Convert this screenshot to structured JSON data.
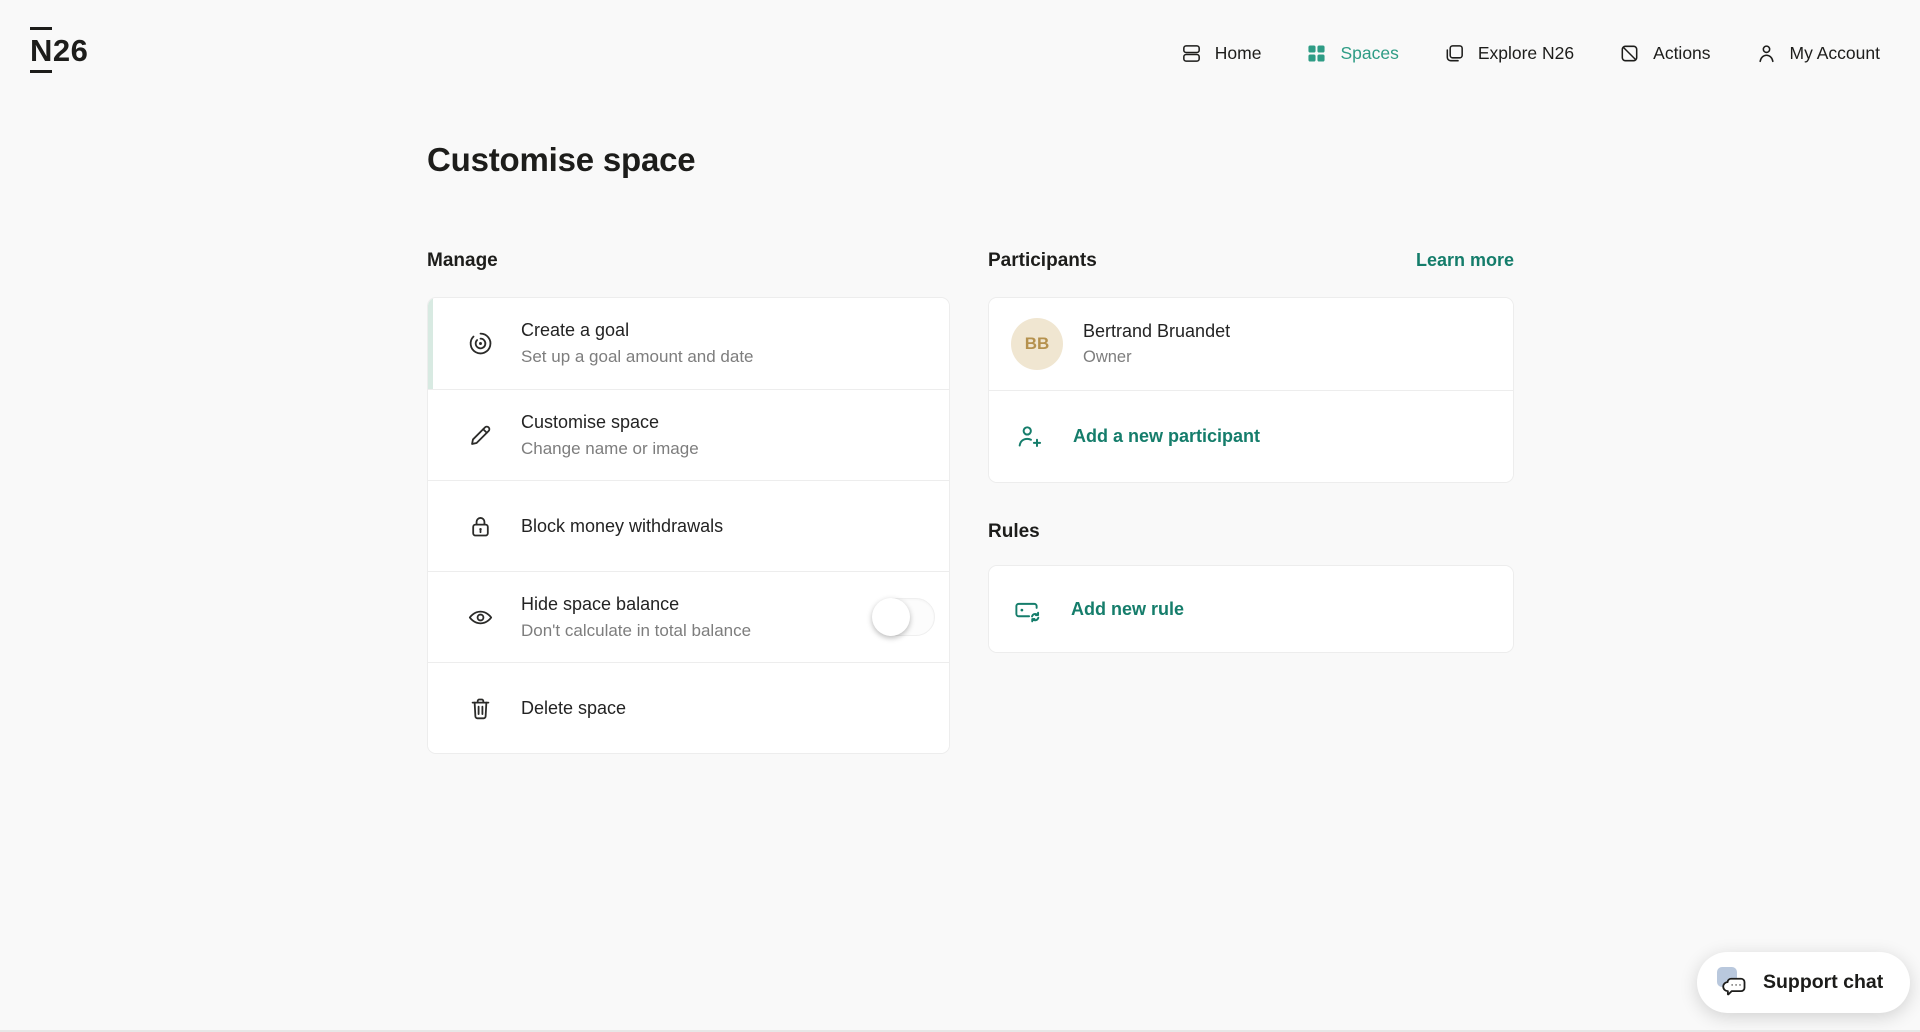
{
  "brand": {
    "logo_n": "N",
    "logo_rest": "26"
  },
  "nav": {
    "items": [
      {
        "label": "Home",
        "icon": "home-icon",
        "active": false
      },
      {
        "label": "Spaces",
        "icon": "spaces-icon",
        "active": true
      },
      {
        "label": "Explore N26",
        "icon": "explore-icon",
        "active": false
      },
      {
        "label": "Actions",
        "icon": "actions-icon",
        "active": false
      },
      {
        "label": "My Account",
        "icon": "my-account-icon",
        "active": false
      }
    ]
  },
  "page": {
    "title": "Customise space"
  },
  "manage": {
    "header": "Manage",
    "items": [
      {
        "title": "Create a goal",
        "subtitle": "Set up a goal amount and date",
        "icon": "goal-target-icon",
        "highlighted": true
      },
      {
        "title": "Customise space",
        "subtitle": "Change name or image",
        "icon": "pencil-icon"
      },
      {
        "title": "Block money withdrawals",
        "subtitle": "",
        "icon": "lock-icon"
      },
      {
        "title": "Hide space balance",
        "subtitle": "Don't calculate in total balance",
        "icon": "eye-icon",
        "toggle": "off"
      },
      {
        "title": "Delete space",
        "subtitle": "",
        "icon": "trash-icon"
      }
    ]
  },
  "participants": {
    "header": "Participants",
    "learn_more": "Learn more",
    "members": [
      {
        "initials": "BB",
        "name": "Bertrand Bruandet",
        "role": "Owner"
      }
    ],
    "add_label": "Add a new participant"
  },
  "rules": {
    "header": "Rules",
    "add_label": "Add new rule"
  },
  "support": {
    "label": "Support chat"
  },
  "colors": {
    "accent_teal": "#2e9c85",
    "link_teal": "#157d6b",
    "text_dark": "#1d1d1b",
    "text_gray": "#7d7d7d",
    "stripe_green": "#d8eae2",
    "avatar_bg": "#f0e6d1",
    "avatar_text": "#b5914d",
    "support_blue": "#b9c8dd"
  }
}
